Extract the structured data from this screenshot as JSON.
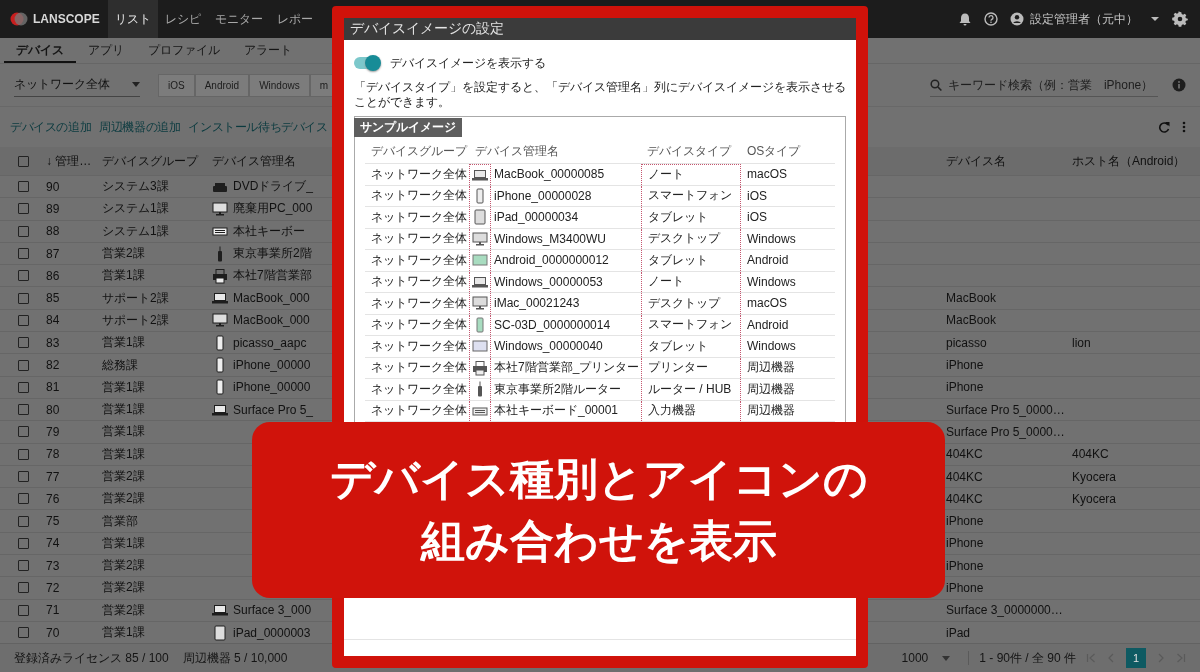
{
  "top_bar": {
    "logo": "LANSCOPE",
    "nav": [
      {
        "label": "リスト",
        "selected": true
      },
      {
        "label": "レシピ",
        "selected": false
      },
      {
        "label": "モニター",
        "selected": false
      },
      {
        "label": "レポー",
        "selected": false
      }
    ],
    "user": "設定管理者（元中）"
  },
  "sub_tabs": [
    {
      "label": "デバイス",
      "selected": true
    },
    {
      "label": "アプリ",
      "selected": false
    },
    {
      "label": "プロファイル",
      "selected": false
    },
    {
      "label": "アラート",
      "selected": false
    }
  ],
  "filter": {
    "group": "ネットワーク全体",
    "platforms": [
      "iOS",
      "Android",
      "Windows",
      "m"
    ]
  },
  "search": {
    "placeholder": "キーワード検索（例：営業　iPhone）"
  },
  "actions": [
    "デバイスの追加",
    "周辺機器の追加",
    "インストール待ちデバイス"
  ],
  "table": {
    "select_all": {
      "checked": false
    },
    "columns": [
      "↓ 管理…",
      "デバイスグループ",
      "デバイス管理名",
      "デバイス名",
      "ホスト名（Android）"
    ],
    "rows": [
      {
        "checked": false,
        "id": "90",
        "group": "システム3課",
        "kind": "drive",
        "name": "DVDドライブ_"
      },
      {
        "checked": false,
        "id": "89",
        "group": "システム1課",
        "kind": "monitor",
        "name": "廃棄用PC_000"
      },
      {
        "checked": false,
        "id": "88",
        "group": "システム1課",
        "kind": "keyboard",
        "name": "本社キーボー"
      },
      {
        "checked": false,
        "id": "87",
        "group": "営業2課",
        "kind": "router",
        "name": "東京事業所2階"
      },
      {
        "checked": false,
        "id": "86",
        "group": "営業1課",
        "kind": "printer",
        "name": "本社7階営業部"
      },
      {
        "checked": false,
        "id": "85",
        "group": "サポート2課",
        "kind": "laptop",
        "name": "MacBook_000",
        "device_name": "MacBook"
      },
      {
        "checked": false,
        "id": "84",
        "group": "サポート2課",
        "kind": "monitor",
        "name": "MacBook_000",
        "device_name": "MacBook"
      },
      {
        "checked": false,
        "id": "83",
        "group": "営業1課",
        "kind": "phone",
        "name": "picasso_aapc",
        "device_name": "picasso",
        "host": "lion"
      },
      {
        "checked": false,
        "id": "82",
        "group": "総務課",
        "kind": "phone",
        "name": "iPhone_00000",
        "device_name": "iPhone"
      },
      {
        "checked": false,
        "id": "81",
        "group": "営業1課",
        "kind": "phone",
        "name": "iPhone_00000",
        "device_name": "iPhone"
      },
      {
        "checked": false,
        "id": "80",
        "group": "営業1課",
        "kind": "laptop",
        "name": "Surface Pro 5_",
        "device_name": "Surface Pro 5_0000…"
      },
      {
        "checked": false,
        "id": "79",
        "group": "営業1課",
        "device_name": "Surface Pro 5_0000…"
      },
      {
        "checked": false,
        "id": "78",
        "group": "営業1課",
        "device_name": "404KC",
        "host": "404KC"
      },
      {
        "checked": false,
        "id": "77",
        "group": "営業2課",
        "device_name": "404KC",
        "host": "Kyocera"
      },
      {
        "checked": false,
        "id": "76",
        "group": "営業2課",
        "device_name": "404KC",
        "host": "Kyocera"
      },
      {
        "checked": false,
        "id": "75",
        "group": "営業部",
        "device_name": "iPhone"
      },
      {
        "checked": false,
        "id": "74",
        "group": "営業1課",
        "device_name": "iPhone"
      },
      {
        "checked": false,
        "id": "73",
        "group": "営業2課",
        "device_name": "iPhone"
      },
      {
        "checked": false,
        "id": "72",
        "group": "営業2課",
        "device_name": "iPhone"
      },
      {
        "checked": false,
        "id": "71",
        "group": "営業2課",
        "kind": "laptop",
        "name": "Surface 3_000",
        "device_name": "Surface 3_0000000…"
      },
      {
        "checked": false,
        "id": "70",
        "group": "営業1課",
        "kind": "tablet",
        "name": "iPad_0000003",
        "device_name": "iPad"
      }
    ]
  },
  "footer": {
    "license": "登録済みライセンス 85 / 100",
    "peripherals": "周辺機器 5 / 10,000",
    "page_size": "1000",
    "range": "1 - 90件 / 全 90 件",
    "pages": [
      {
        "label": "1",
        "selected": true
      }
    ]
  },
  "modal": {
    "title": "デバイスイメージの設定",
    "toggle": {
      "label": "デバイスイメージを表示する",
      "on": true
    },
    "description": "「デバイスタイプ」を設定すると、「デバイス管理名」列にデバイスイメージを表示させることができます。",
    "sample": {
      "label": "サンプルイメージ",
      "columns": [
        "デバイスグループ",
        "デバイス管理名",
        "デバイスタイプ",
        "OSタイプ"
      ],
      "rows": [
        {
          "group": "ネットワーク全体",
          "kind": "laptop",
          "name": "MacBook_00000085",
          "type": "ノート",
          "os": "macOS"
        },
        {
          "group": "ネットワーク全体",
          "kind": "phone",
          "name": "iPhone_00000028",
          "type": "スマートフォン",
          "os": "iOS"
        },
        {
          "group": "ネットワーク全体",
          "kind": "tablet",
          "name": "iPad_00000034",
          "type": "タブレット",
          "os": "iOS"
        },
        {
          "group": "ネットワーク全体",
          "kind": "monitor",
          "name": "Windows_M3400WU",
          "type": "デスクトップ",
          "os": "Windows"
        },
        {
          "group": "ネットワーク全体",
          "kind": "android-tablet",
          "name": "Android_0000000012",
          "type": "タブレット",
          "os": "Android"
        },
        {
          "group": "ネットワーク全体",
          "kind": "laptop",
          "name": "Windows_00000053",
          "type": "ノート",
          "os": "Windows"
        },
        {
          "group": "ネットワーク全体",
          "kind": "monitor",
          "name": "iMac_00021243",
          "type": "デスクトップ",
          "os": "macOS"
        },
        {
          "group": "ネットワーク全体",
          "kind": "android-phone",
          "name": "SC-03D_0000000014",
          "type": "スマートフォン",
          "os": "Android"
        },
        {
          "group": "ネットワーク全体",
          "kind": "landscape-tablet",
          "name": "Windows_00000040",
          "type": "タブレット",
          "os": "Windows"
        },
        {
          "group": "ネットワーク全体",
          "kind": "printer",
          "name": "本社7階営業部_プリンター",
          "type": "プリンター",
          "os": "周辺機器"
        },
        {
          "group": "ネットワーク全体",
          "kind": "router",
          "name": "東京事業所2階ルーター",
          "type": "ルーター / HUB",
          "os": "周辺機器"
        },
        {
          "group": "ネットワーク全体",
          "kind": "keyboard",
          "name": "本社キーボード_00001",
          "type": "入力機器",
          "os": "周辺機器"
        }
      ]
    }
  },
  "banner": {
    "lines": [
      "デバイス種別とアイコンの",
      "組み合わせを表示"
    ]
  }
}
